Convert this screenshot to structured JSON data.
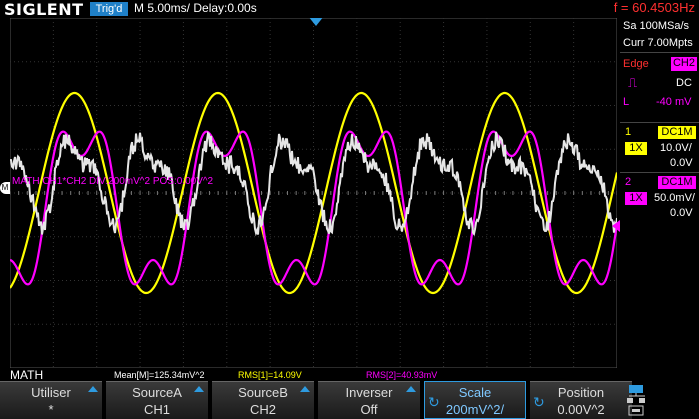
{
  "header": {
    "brand": "SIGLENT",
    "trigger_status": "Trig'd",
    "timebase": "M 5.00ms/ Delay:0.00s",
    "frequency": "f = 60.4503Hz"
  },
  "acquisition": {
    "sample_rate": "Sa 100MSa/s",
    "memory": "Curr 7.00Mpts"
  },
  "trigger": {
    "type": "Edge",
    "source": "CH2",
    "coupling": "DC",
    "level_label": "L",
    "level": "-40 mV"
  },
  "channels": [
    {
      "num": "1",
      "coupling": "DC1M",
      "probe": "1X",
      "scale": "10.0V/",
      "offset": "0.0V",
      "color": "#ffff00"
    },
    {
      "num": "2",
      "coupling": "DC1M",
      "probe": "1X",
      "scale": "50.0mV/",
      "offset": "0.0V",
      "color": "#ff00ff"
    }
  ],
  "math_info": "MATH   CH1*CH2   DIV:200mV^2   POS:0.00V^2",
  "math_label": "MATH",
  "measurements": {
    "mean": "Mean[M]=125.34mV^2",
    "rms1": "RMS[1]=14.09V",
    "rms2": "RMS[2]=40.93mV"
  },
  "softkeys": [
    {
      "l1": "Utiliser",
      "l2": "*"
    },
    {
      "l1": "SourceA",
      "l2": "CH1"
    },
    {
      "l1": "SourceB",
      "l2": "CH2"
    },
    {
      "l1": "Inverser",
      "l2": "Off"
    },
    {
      "l1": "Scale",
      "l2": "200mV^2/"
    },
    {
      "l1": "Position",
      "l2": "0.00V^2"
    }
  ],
  "colors": {
    "ch1": "#ffff00",
    "ch2": "#ff00ff",
    "math": "#e0e0e0",
    "accent": "#2e9be0"
  }
}
